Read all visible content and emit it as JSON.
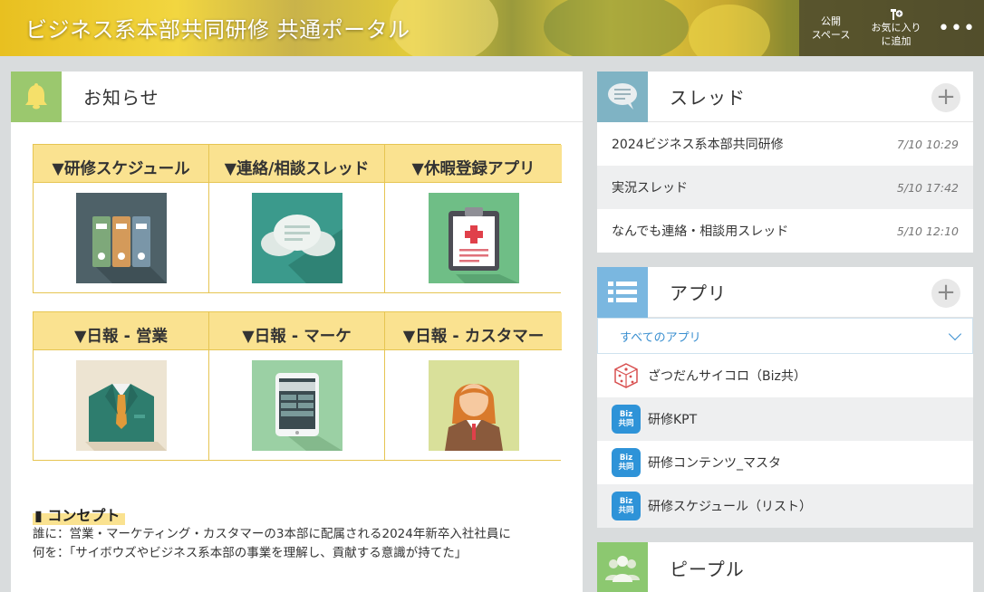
{
  "header": {
    "title": "ビジネス系本部共同研修 共通ポータル",
    "public_space": [
      "公開",
      "スペース"
    ],
    "favorite": [
      "お気に入り",
      "に追加"
    ],
    "more": "•••"
  },
  "notice": {
    "title": "お知らせ",
    "table1": [
      {
        "label": "▼研修スケジュール",
        "icon": "binders-icon"
      },
      {
        "label": "▼連絡/相談スレッド",
        "icon": "chat-bubbles-icon"
      },
      {
        "label": "▼休暇登録アプリ",
        "icon": "clipboard-icon"
      }
    ],
    "table2": [
      {
        "label": "▼日報 - 営業",
        "icon": "suit-icon"
      },
      {
        "label": "▼日報 - マーケ",
        "icon": "tablet-icon"
      },
      {
        "label": "▼日報 - カスタマー",
        "icon": "woman-icon"
      }
    ],
    "concept_title": "▮ コンセプト",
    "concept_lines": [
      "誰に：営業・マーケティング・カスタマーの3本部に配属される2024年新卒入社社員に",
      "何を：「サイボウズやビジネス系本部の事業を理解し、貢献する意識が持てた」"
    ]
  },
  "threads": {
    "title": "スレッド",
    "add": "+",
    "items": [
      {
        "name": "2024ビジネス系本部共同研修",
        "date": "7/10 10:29"
      },
      {
        "name": "実況スレッド",
        "date": "5/10 17:42"
      },
      {
        "name": "なんでも連絡・相談用スレッド",
        "date": "5/10 12:10"
      }
    ]
  },
  "apps": {
    "title": "アプリ",
    "add": "+",
    "filter": "すべてのアプリ",
    "biz_badge": [
      "Biz",
      "共同"
    ],
    "items": [
      {
        "name": "ざつだんサイコロ（Biz共）",
        "icon": "dice-icon"
      },
      {
        "name": "研修KPT",
        "icon": "biz-icon"
      },
      {
        "name": "研修コンテンツ_マスタ",
        "icon": "biz-icon"
      },
      {
        "name": "研修スケジュール（リスト）",
        "icon": "biz-icon"
      }
    ]
  },
  "people": {
    "title": "ピープル"
  },
  "colors": {
    "accent": "#fae290",
    "grid_border": "#e6c552",
    "link_blue": "#3a8fd0",
    "bell_green": "#9bc86e",
    "thread_blue": "#7fb3c4",
    "app_blue": "#7ab7e0"
  }
}
